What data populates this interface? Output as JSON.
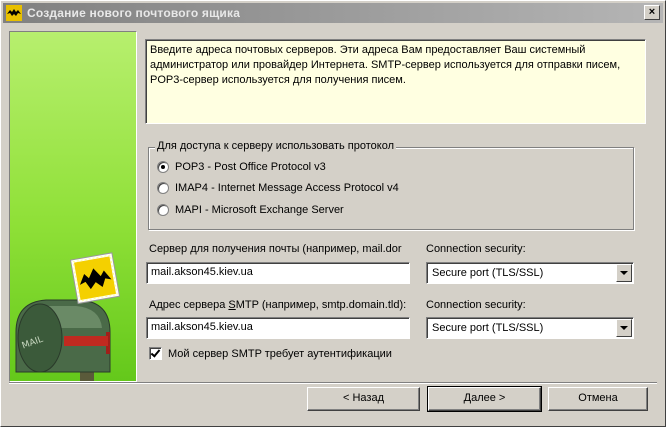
{
  "window": {
    "title": "Создание нового почтового ящика",
    "close_label": "×"
  },
  "sidebar": {
    "illustration": "mailbox-with-bat-letter",
    "mailbox_label": "MAIL"
  },
  "info": {
    "text": "Введите адреса почтовых серверов. Эти адреса Вам предоставляет Ваш системный администратор или провайдер Интернета. SMTP-сервер используется для отправки писем, POP3-сервер используется для получения писем."
  },
  "protocol": {
    "legend": "Для доступа к серверу использовать протокол",
    "options": [
      {
        "label": "POP3 - Post Office Protocol v3",
        "checked": true
      },
      {
        "label": "IMAP4 - Internet Message Access Protocol v4",
        "checked": false
      },
      {
        "label": "MAPI - Microsoft Exchange Server",
        "checked": false
      }
    ]
  },
  "incoming": {
    "label": "Сервер для получения почты  (например, mail.dor",
    "security_label": "Connection security:",
    "value": "mail.akson45.kiev.ua",
    "security_value": "Secure port (TLS/SSL)"
  },
  "outgoing": {
    "label_prefix": "Адрес сервера ",
    "label_underlined": "S",
    "label_suffix": "MTP (например, smtp.domain.tld):",
    "security_label": "Connection security:",
    "value": "mail.akson45.kiev.ua",
    "security_value": "Secure port (TLS/SSL)"
  },
  "smtp_auth": {
    "label": "Мой сервер SMTP требует аутентификации",
    "checked": true
  },
  "buttons": {
    "back": "<  Назад",
    "next": "Далее  >",
    "cancel": "Отмена"
  },
  "colors": {
    "window_bg": "#d4d0c8",
    "titlebar_inactive": "#808080",
    "sidepanel_green": "#8fe037",
    "info_bg": "#ffffe1"
  }
}
